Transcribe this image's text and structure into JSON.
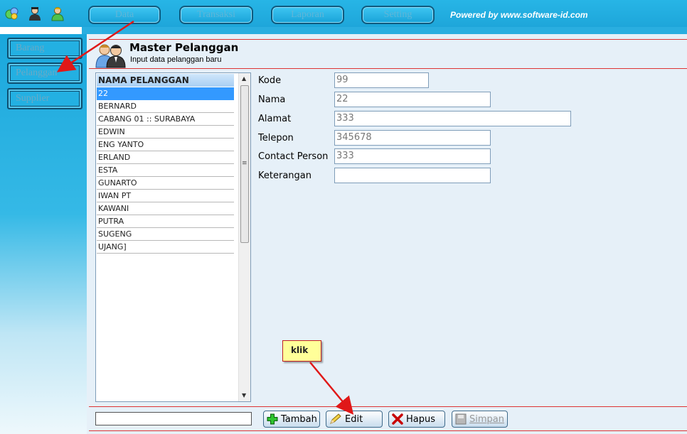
{
  "topbar": {
    "menu": [
      {
        "label": "Data"
      },
      {
        "label": "Transaksi"
      },
      {
        "label": "Laporan"
      },
      {
        "label": "Setting"
      }
    ],
    "powered_by": "Powered by www.software-id.com",
    "icons": [
      "network-icon",
      "user-dark-icon",
      "user-green-icon"
    ]
  },
  "sidebar": {
    "items": [
      {
        "label": "Barang"
      },
      {
        "label": "Pelanggan"
      },
      {
        "label": "Supplier"
      }
    ]
  },
  "header": {
    "title": "Master Pelanggan",
    "subtitle": "Input data pelanggan baru",
    "icon": "customers-icon"
  },
  "customer_list": {
    "column": "NAMA PELANGGAN",
    "rows": [
      "22",
      "BERNARD",
      "CABANG 01 :: SURABAYA",
      "EDWIN",
      "ENG YANTO",
      "ERLAND",
      "ESTA",
      "GUNARTO",
      "IWAN PT",
      "KAWANI",
      "PUTRA",
      "SUGENG",
      "UJANG]"
    ],
    "selected": "22"
  },
  "form": {
    "kode_label": "Kode",
    "kode_value": "99",
    "nama_label": "Nama",
    "nama_value": "22",
    "alamat_label": "Alamat",
    "alamat_value": "333",
    "telepon_label": "Telepon",
    "telepon_value": "345678",
    "contact_label": "Contact Person",
    "contact_value": "333",
    "keterangan_label": "Keterangan",
    "keterangan_value": ""
  },
  "buttons": {
    "tambah": "Tambah",
    "edit": "Edit",
    "hapus": "Hapus",
    "simpan": "Simpan"
  },
  "annotation": {
    "callout_text": "klik",
    "arrow_color": "#e01818"
  },
  "colors": {
    "topbar": "#1ea6da",
    "selection": "#3399ff",
    "header_rule": "#dd3333"
  }
}
